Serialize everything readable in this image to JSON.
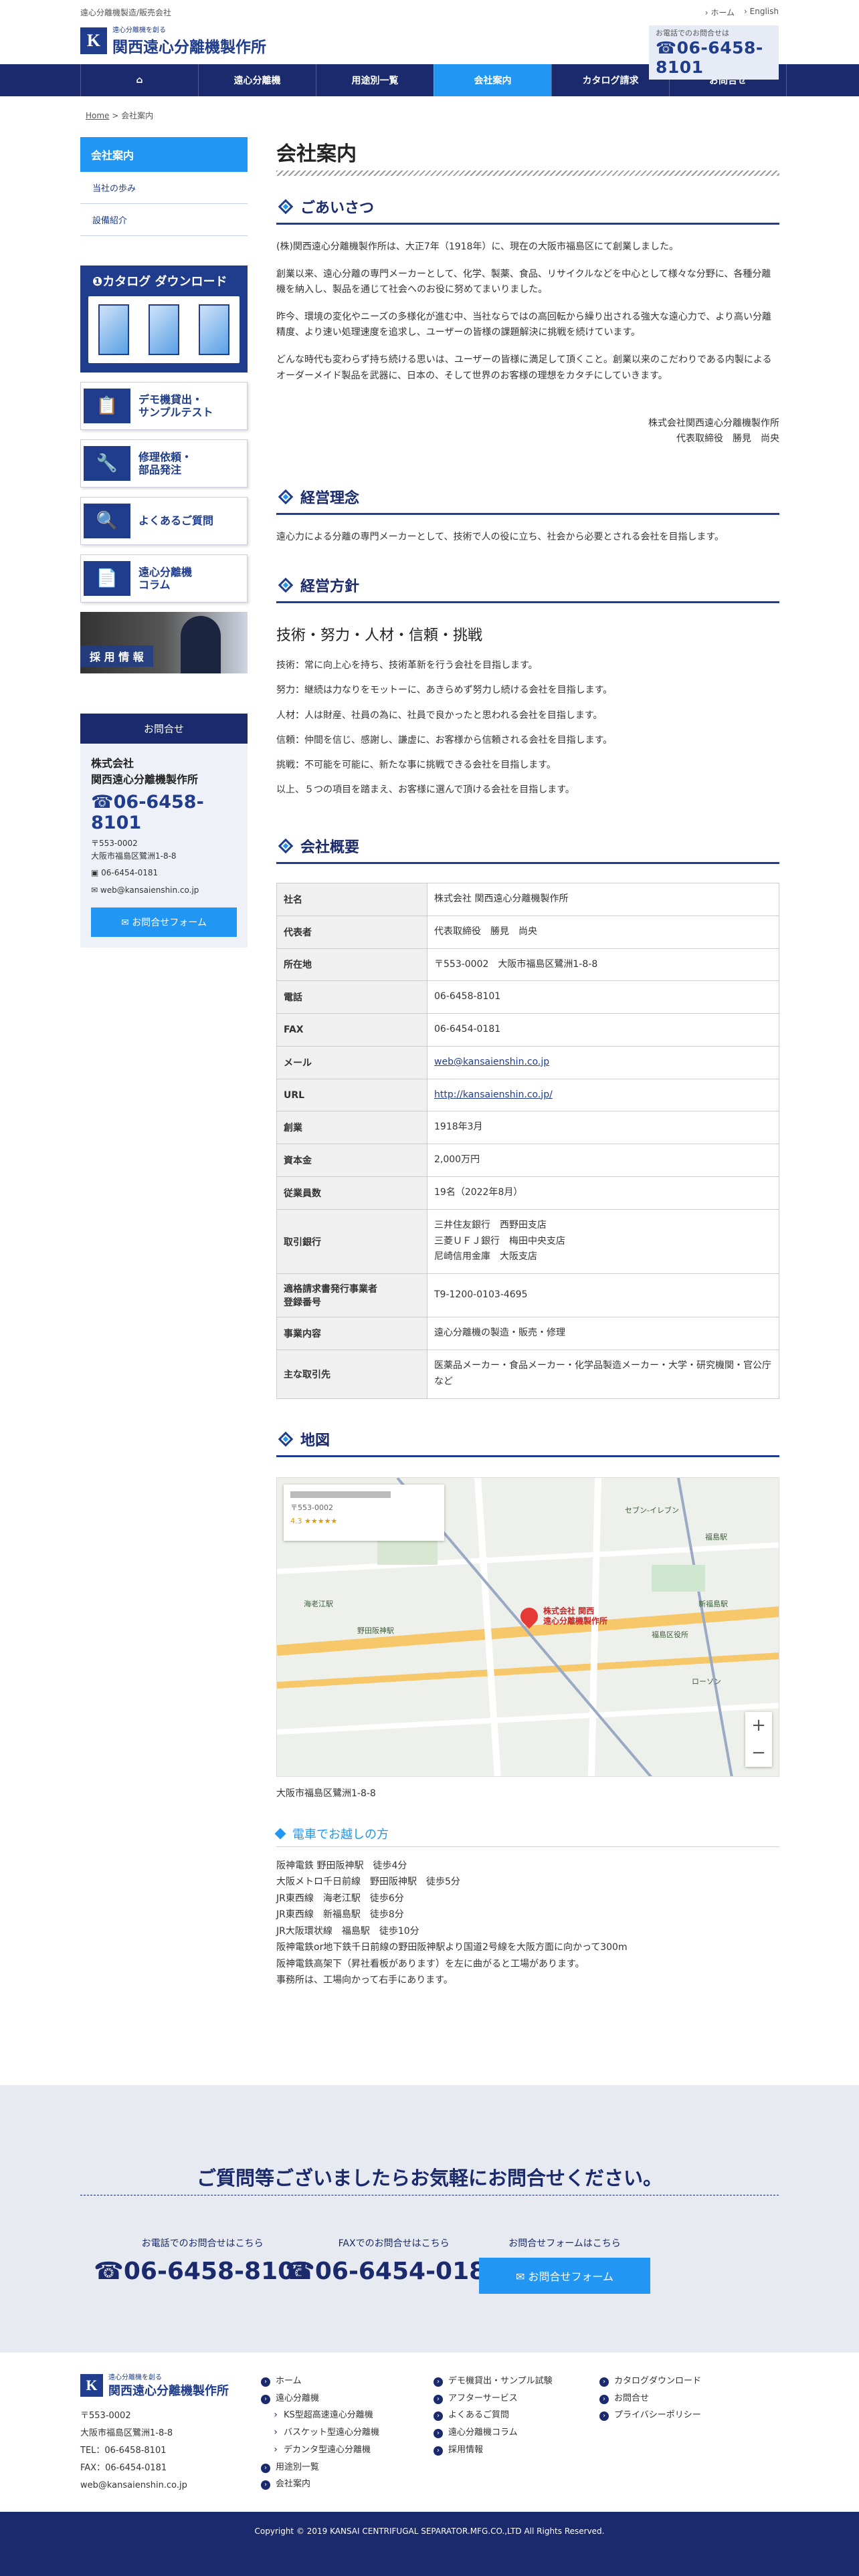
{
  "header": {
    "tagline": "遠心分離機製造/販売会社",
    "logo_small": "遠心分離機を創る",
    "logo_name": "関西遠心分離機製作所",
    "logo_mark": "K",
    "top_links": [
      "ホーム",
      "English"
    ],
    "phone_label": "お電話でのお問合せは",
    "phone": "06-6458-8101"
  },
  "nav": {
    "items": [
      "遠心分離機",
      "用途別一覧",
      "会社案内",
      "カタログ請求",
      "お問合せ"
    ],
    "active": "会社案内"
  },
  "breadcrumb": {
    "home": "Home",
    "sep": ">",
    "current": "会社案内"
  },
  "sidebar": {
    "head": "会社案内",
    "links": [
      "当社の歩み",
      "設備紹介"
    ],
    "catalog": "カタログ ダウンロード",
    "banners": [
      {
        "line1": "デモ機貸出・",
        "line2": "サンプルテスト"
      },
      {
        "line1": "修理依頼・",
        "line2": "部品発注"
      },
      {
        "line1": "よくあるご質問",
        "line2": ""
      },
      {
        "line1": "遠心分離機",
        "line2": "コラム"
      }
    ],
    "recruit": "採 用 情 報",
    "contact": {
      "head": "お問合せ",
      "company1": "株式会社",
      "company2": "関西遠心分離機製作所",
      "phone": "06-6458-8101",
      "zip": "〒553-0002",
      "addr": "大阪市福島区鷺洲1-8-8",
      "fax": "06-6454-0181",
      "email": "web@kansaienshin.co.jp",
      "form": "お問合せフォーム"
    }
  },
  "main": {
    "title": "会社案内",
    "greeting": {
      "head": "ごあいさつ",
      "p1": "(株)関西遠心分離機製作所は、大正7年（1918年）に、現在の大阪市福島区にて創業しました。",
      "p2": "創業以来、遠心分離の専門メーカーとして、化学、製薬、食品、リサイクルなどを中心として様々な分野に、各種分離機を納入し、製品を通じて社会へのお役に努めてまいりました。",
      "p3": "昨今、環境の変化やニーズの多様化が進む中、当社ならではの高回転から繰り出される強大な遠心力で、より高い分離精度、より速い処理速度を追求し、ユーザーの皆様の課題解決に挑戦を続けています。",
      "p4": "どんな時代も変わらず持ち続ける思いは、ユーザーの皆様に満足して頂くこと。創業以来のこだわりである内製によるオーダーメイド製品を武器に、日本の、そして世界のお客様の理想をカタチにしていきます。",
      "sign1": "株式会社関西遠心分離機製作所",
      "sign2": "代表取締役　勝見　尚央"
    },
    "philosophy": {
      "head": "経営理念",
      "text": "遠心力による分離の専門メーカーとして、技術で人の役に立ち、社会から必要とされる会社を目指します。"
    },
    "policy": {
      "head": "経営方針",
      "motto": "技術・努力・人材・信頼・挑戦",
      "items": [
        "技術：常に向上心を持ち、技術革新を行う会社を目指します。",
        "努力：継続は力なりをモットーに、あきらめず努力し続ける会社を目指します。",
        "人材：人は財産、社員の為に、社員で良かったと思われる会社を目指します。",
        "信頼：仲間を信じ、感謝し、謙虚に、お客様から信頼される会社を目指します。",
        "挑戦：不可能を可能に、新たな事に挑戦できる会社を目指します。",
        "以上、５つの項目を踏まえ、お客様に選んで頂ける会社を目指します。"
      ]
    },
    "overview": {
      "head": "会社概要",
      "rows": [
        {
          "k": "社名",
          "v": "株式会社 関西遠心分離機製作所"
        },
        {
          "k": "代表者",
          "v": "代表取締役　勝見　尚央"
        },
        {
          "k": "所在地",
          "v": "〒553-0002　大阪市福島区鷺洲1-8-8"
        },
        {
          "k": "電話",
          "v": "06-6458-8101"
        },
        {
          "k": "FAX",
          "v": "06-6454-0181"
        },
        {
          "k": "メール",
          "v": "web@kansaienshin.co.jp",
          "link": true
        },
        {
          "k": "URL",
          "v": "http://kansaienshin.co.jp/",
          "link": true
        },
        {
          "k": "創業",
          "v": "1918年3月"
        },
        {
          "k": "資本金",
          "v": "2,000万円"
        },
        {
          "k": "従業員数",
          "v": "19名（2022年8月）"
        },
        {
          "k": "取引銀行",
          "v": "三井住友銀行　西野田支店\n三菱ＵＦＪ銀行　梅田中央支店\n尼崎信用金庫　大阪支店"
        },
        {
          "k": "適格請求書発行事業者\n登録番号",
          "v": "T9-1200-0103-4695"
        },
        {
          "k": "事業内容",
          "v": "遠心分離機の製造・販売・修理"
        },
        {
          "k": "主な取引先",
          "v": "医薬品メーカー・食品メーカー・化学品製造メーカー・大学・研究機関・官公庁など"
        }
      ]
    },
    "map": {
      "head": "地図",
      "pin_label1": "株式会社 関西",
      "pin_label2": "遠心分離機製作所",
      "rating": "4.3 ★★★★★",
      "zip": "〒553-0002",
      "places": [
        "セブン-イレブン",
        "福島駅",
        "野田阪神駅",
        "福島区役所",
        "新福島駅",
        "海老江駅",
        "ローソン"
      ],
      "address": "大阪市福島区鷺洲1-8-8"
    },
    "access": {
      "head": "電車でお越しの方",
      "lines": [
        "阪神電鉄 野田阪神駅　徒歩4分",
        "大阪メトロ千日前線　野田阪神駅　徒歩5分",
        "JR東西線　海老江駅　徒歩6分",
        "JR東西線　新福島駅　徒歩8分",
        "JR大阪環状線　福島駅　徒歩10分",
        "阪神電鉄or地下鉄千日前線の野田阪神駅より国道2号線を大阪方面に向かって300m",
        "阪神電鉄高架下（昇社看板があります）を左に曲がると工場があります。",
        "事務所は、工場向かって右手にあります。"
      ]
    }
  },
  "cta": {
    "title": "ご質問等ございましたらお気軽にお問合せください。",
    "phone_label": "お電話でのお問合せはこちら",
    "phone": "06-6458-8101",
    "fax_label": "FAXでのお問合せはこちら",
    "fax": "06-6454-0181",
    "form_label": "お問合せフォームはこちら",
    "form": "お問合せフォーム"
  },
  "footer": {
    "zip": "〒553-0002",
    "addr": "大阪市福島区鷺洲1-8-8",
    "tel": "TEL：06-6458-8101",
    "fax": "FAX：06-6454-0181",
    "email": "web@kansaienshin.co.jp",
    "col1": [
      "ホーム",
      "遠心分離機",
      "KS型超高速遠心分離機",
      "バスケット型遠心分離機",
      "デカンタ型遠心分離機",
      "用途別一覧",
      "会社案内"
    ],
    "col2": [
      "デモ機貸出・サンプル試験",
      "アフターサービス",
      "よくあるご質問",
      "遠心分離機コラム",
      "採用情報"
    ],
    "col3": [
      "カタログダウンロード",
      "お問合せ",
      "プライバシーポリシー"
    ],
    "copyright": "Copyright © 2019 KANSAI CENTRIFUGAL SEPARATOR.MFG.CO.,LTD All Rights Reserved."
  },
  "colors": {
    "navy": "#1a2a6c",
    "blue": "#2196f3",
    "brand": "#1f3d8c"
  }
}
